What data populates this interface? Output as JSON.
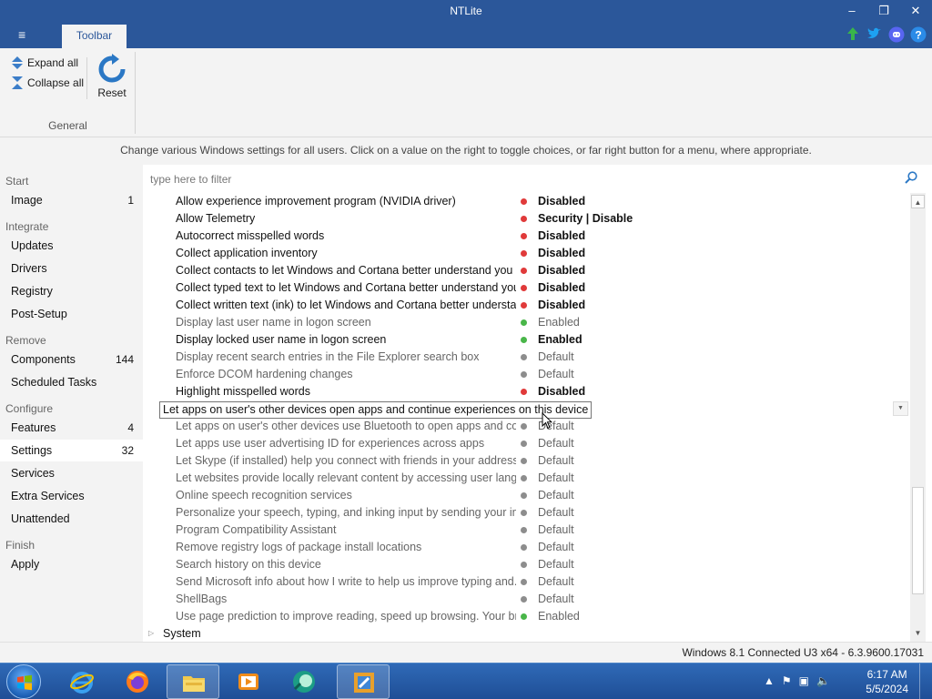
{
  "window": {
    "title": "NTLite",
    "minimize": "–",
    "restore": "❐",
    "close": "✕"
  },
  "ribbon_tabs": {
    "menu_icon": "≡",
    "toolbar": "Toolbar"
  },
  "toolbar": {
    "expand_all": "Expand all",
    "collapse_all": "Collapse all",
    "reset": "Reset",
    "group_general": "General"
  },
  "description": "Change various Windows settings for all users. Click on a value on the right to toggle choices, or far right button for a menu, where appropriate.",
  "sidebar": {
    "start": "Start",
    "image": {
      "label": "Image",
      "count": "1"
    },
    "integrate": "Integrate",
    "updates": "Updates",
    "drivers": "Drivers",
    "registry": "Registry",
    "post_setup": "Post-Setup",
    "remove": "Remove",
    "components": {
      "label": "Components",
      "count": "144"
    },
    "scheduled_tasks": "Scheduled Tasks",
    "configure": "Configure",
    "features": {
      "label": "Features",
      "count": "4"
    },
    "settings": {
      "label": "Settings",
      "count": "32"
    },
    "services": "Services",
    "extra_services": "Extra Services",
    "unattended": "Unattended",
    "finish": "Finish",
    "apply": "Apply"
  },
  "filter": {
    "placeholder": "type here to filter"
  },
  "rows": [
    {
      "name": "Allow experience improvement program (NVIDIA driver)",
      "status": "red",
      "value": "Disabled",
      "bold": true
    },
    {
      "name": "Allow Telemetry",
      "status": "red",
      "value": "Security | Disable",
      "bold": true
    },
    {
      "name": "Autocorrect misspelled words",
      "status": "red",
      "value": "Disabled",
      "bold": true
    },
    {
      "name": "Collect application inventory",
      "status": "red",
      "value": "Disabled",
      "bold": true
    },
    {
      "name": "Collect contacts to let Windows and Cortana better understand you",
      "status": "red",
      "value": "Disabled",
      "bold": true
    },
    {
      "name": "Collect typed text to let Windows and Cortana better understand you",
      "status": "red",
      "value": "Disabled",
      "bold": true
    },
    {
      "name": "Collect written text (ink) to let Windows and Cortana better understa...",
      "status": "red",
      "value": "Disabled",
      "bold": true
    },
    {
      "name": "Display last user name in logon screen",
      "status": "green",
      "value": "Enabled",
      "bold": false
    },
    {
      "name": "Display locked user name in logon screen",
      "status": "green",
      "value": "Enabled",
      "bold": true
    },
    {
      "name": "Display recent search entries in the File Explorer search box",
      "status": "grey",
      "value": "Default",
      "bold": false
    },
    {
      "name": "Enforce DCOM hardening changes",
      "status": "grey",
      "value": "Default",
      "bold": false
    },
    {
      "name": "Highlight misspelled words",
      "status": "red",
      "value": "Disabled",
      "bold": true
    },
    {
      "name": "Let apps on user's other devices open apps and continue experiences on this device",
      "status": "grey",
      "value": "Default",
      "bold": false
    },
    {
      "name": "Let apps on user's other devices use Bluetooth to open apps and con...",
      "status": "grey",
      "value": "Default",
      "bold": false
    },
    {
      "name": "Let apps use user advertising ID for experiences across apps",
      "status": "grey",
      "value": "Default",
      "bold": false
    },
    {
      "name": "Let Skype (if installed) help you connect with friends in your address ...",
      "status": "grey",
      "value": "Default",
      "bold": false
    },
    {
      "name": "Let websites provide locally relevant content by accessing user langu...",
      "status": "grey",
      "value": "Default",
      "bold": false
    },
    {
      "name": "Online speech recognition services",
      "status": "grey",
      "value": "Default",
      "bold": false
    },
    {
      "name": "Personalize your speech, typing, and inking input by sending your in...",
      "status": "grey",
      "value": "Default",
      "bold": false
    },
    {
      "name": "Program Compatibility Assistant",
      "status": "grey",
      "value": "Default",
      "bold": false
    },
    {
      "name": "Remove registry logs of package install locations",
      "status": "grey",
      "value": "Default",
      "bold": false
    },
    {
      "name": "Search history on this device",
      "status": "grey",
      "value": "Default",
      "bold": false
    },
    {
      "name": "Send Microsoft info about how I write to help us improve typing and...",
      "status": "grey",
      "value": "Default",
      "bold": false
    },
    {
      "name": "ShellBags",
      "status": "grey",
      "value": "Default",
      "bold": false
    },
    {
      "name": "Use page prediction to improve reading, speed up browsing. Your br...",
      "status": "green",
      "value": "Enabled",
      "bold": false
    }
  ],
  "group_row": {
    "name": "System"
  },
  "tooltip": "Let apps on user's other devices open apps and continue experiences on this device",
  "status_bar": "Windows 8.1 Connected U3 x64 - 6.3.9600.17031",
  "clock": {
    "time": "6:17 AM",
    "date": "5/5/2024"
  },
  "colors": {
    "accent": "#2b579a",
    "red": "#e03a3a",
    "green": "#49b649",
    "grey": "#8d8d8d"
  }
}
